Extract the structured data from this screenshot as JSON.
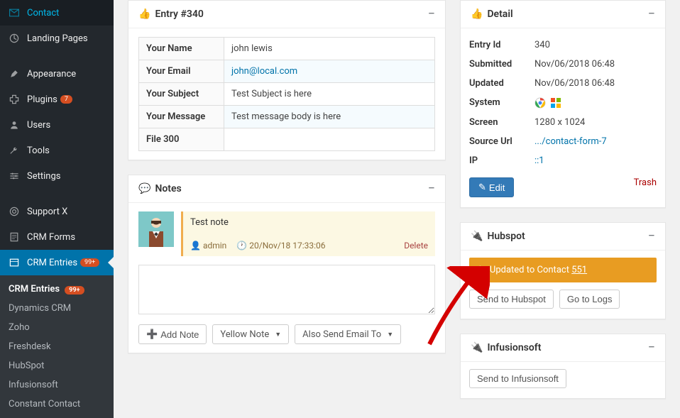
{
  "sidebar": {
    "items": [
      {
        "label": "Contact"
      },
      {
        "label": "Landing Pages"
      },
      {
        "label": "Appearance"
      },
      {
        "label": "Plugins",
        "badge": "7"
      },
      {
        "label": "Users"
      },
      {
        "label": "Tools"
      },
      {
        "label": "Settings"
      },
      {
        "label": "Support X"
      },
      {
        "label": "CRM Forms"
      },
      {
        "label": "CRM Entries",
        "badge": "99+"
      }
    ],
    "submenu": [
      {
        "label": "CRM Entries",
        "badge": "99+"
      },
      {
        "label": "Dynamics CRM"
      },
      {
        "label": "Zoho"
      },
      {
        "label": "Freshdesk"
      },
      {
        "label": "HubSpot"
      },
      {
        "label": "Infusionsoft"
      },
      {
        "label": "Constant Contact"
      }
    ]
  },
  "entry": {
    "title": "Entry #340",
    "fields": {
      "name_label": "Your Name",
      "name_value": "john lewis",
      "email_label": "Your Email",
      "email_value": "john@local.com",
      "subject_label": "Your Subject",
      "subject_value": "Test Subject is here",
      "message_label": "Your Message",
      "message_value": "Test message body is here",
      "file_label": "File 300",
      "file_value": ""
    }
  },
  "notes": {
    "title": "Notes",
    "list": [
      {
        "text": "Test note",
        "author": "admin",
        "timestamp": "20/Nov/18 17:33:06",
        "delete_label": "Delete"
      }
    ],
    "add_button": "Add Note",
    "color_select": "Yellow Note",
    "email_select": "Also Send Email To"
  },
  "detail": {
    "title": "Detail",
    "entry_id_label": "Entry Id",
    "entry_id_value": "340",
    "submitted_label": "Submitted",
    "submitted_value": "Nov/06/2018 06:48",
    "updated_label": "Updated",
    "updated_value": "Nov/06/2018 06:48",
    "system_label": "System",
    "screen_label": "Screen",
    "screen_value": "1280 x 1024",
    "source_label": "Source Url",
    "source_value": ".../contact-form-7",
    "ip_label": "IP",
    "ip_value": "::1",
    "edit_button": "Edit",
    "trash_link": "Trash"
  },
  "hubspot": {
    "title": "Hubspot",
    "status_text": "Updated to Contact",
    "status_id": "551",
    "send_button": "Send to Hubspot",
    "logs_button": "Go to Logs"
  },
  "infusionsoft": {
    "title": "Infusionsoft",
    "send_button": "Send to Infusionsoft"
  }
}
